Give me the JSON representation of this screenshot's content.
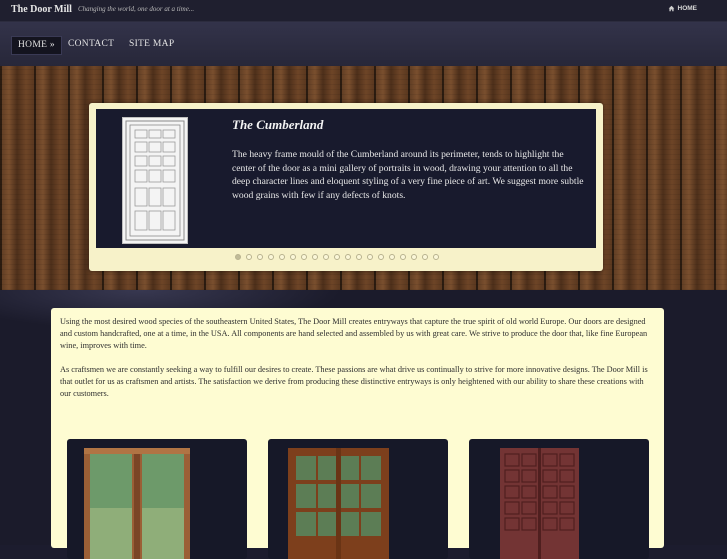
{
  "header": {
    "site_title": "The Door Mill",
    "tagline": "Changing the world, one door at a time...",
    "top_link": "HOME"
  },
  "nav": {
    "items": [
      {
        "label": "HOME »",
        "active": true
      },
      {
        "label": "CONTACT",
        "active": false
      },
      {
        "label": "SITE MAP",
        "active": false
      }
    ]
  },
  "slider": {
    "title": "The Cumberland",
    "text": "The heavy frame mould of the Cumberland around its perimeter, tends to highlight the center of the door as a mini gallery of portraits in wood, drawing your attention to all the deep character lines and eloquent styling of a very fine piece of art. We suggest more subtle wood grains with few if any defects of knots.",
    "slide_count": 19,
    "active_slide": 1
  },
  "content": {
    "paragraph1": "Using the most desired wood species of the southeastern United States, The Door Mill creates entryways that capture the true spirit of old world Europe. Our doors are designed and custom handcrafted, one at a time, in the USA. All components are hand selected and assembled by us with great care. We strive to produce the door that, like fine European wine, improves with time.",
    "paragraph2": "As craftsmen we are constantly seeking a way to fulfill our desires to create. These passions are what drive us continually to strive for more innovative designs. The Door Mill is that outlet for us as craftsmen and artists. The satisfaction we derive from producing these distinctive entryways is only heightened with our ability to share these creations with our customers."
  },
  "colors": {
    "page_bg": "#1c1c2e",
    "content_bg": "#fefcd2",
    "slider_frame": "#f7f2c9",
    "slider_inner": "#181a2d"
  },
  "icons": {
    "home": "home-icon"
  }
}
